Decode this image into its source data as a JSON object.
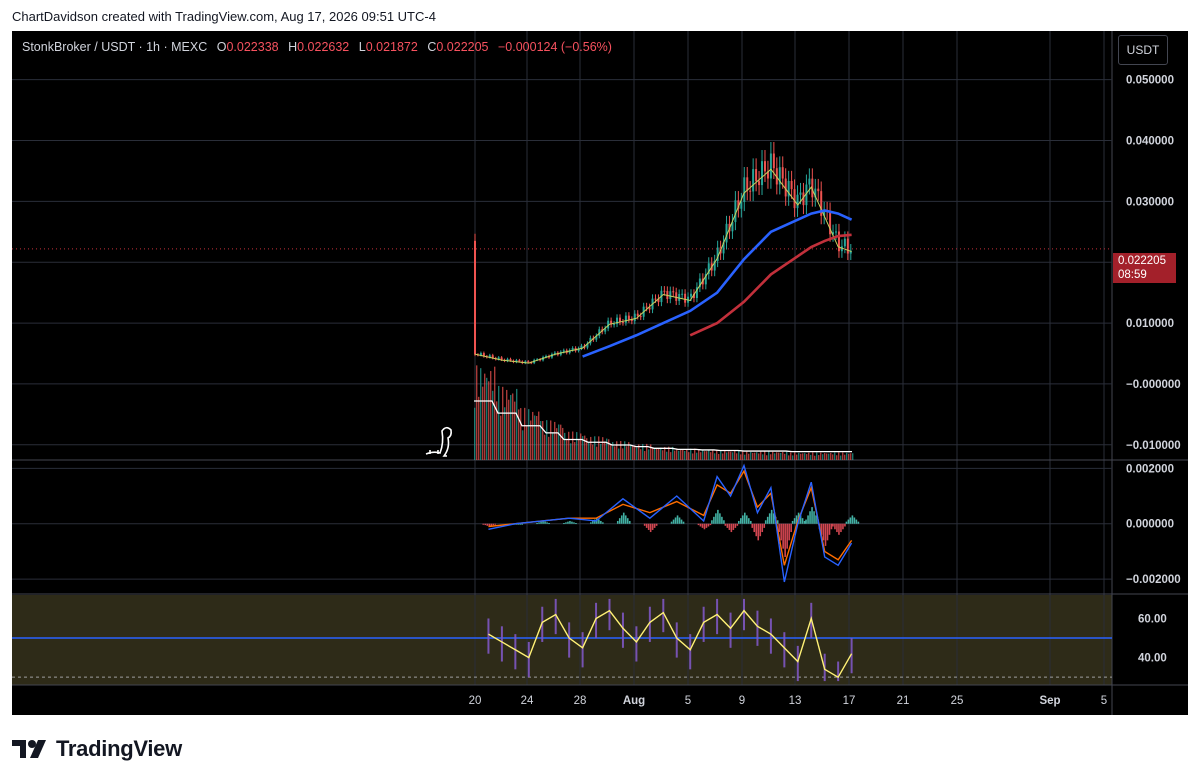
{
  "credit": "ChartDavidson created with TradingView.com, Aug 17, 2026 09:51 UTC-4",
  "legend": {
    "symbol": "StonkBroker / USDT · 1h · MEXC",
    "open_label": "O",
    "open": "0.022338",
    "high_label": "H",
    "high": "0.022632",
    "low_label": "L",
    "low": "0.021872",
    "close_label": "C",
    "close": "0.022205",
    "change": "−0.000124 (−0.56%)"
  },
  "currency_button": "USDT",
  "last_price_tag": {
    "price": "0.022205",
    "countdown": "08:59"
  },
  "brand": "TradingView",
  "colors": {
    "candle_up": "#26a69a",
    "candle_down": "#ef5350",
    "ma_fast": "#2962ff",
    "ma_slow": "#c2303b",
    "macd_line": "#2962ff",
    "macd_signal": "#ff6d00",
    "rsi_line": "#fff176",
    "rsi_band": "#7e57c2",
    "rsi_mid": "#2962ff"
  },
  "chart_data": [
    {
      "type": "line",
      "panel": "price",
      "y_ticks": [
        "0.050000",
        "0.040000",
        "0.030000",
        "0.020000",
        "0.010000",
        "−0.000000",
        "−0.010000"
      ],
      "ylim": [
        -0.0125,
        0.058
      ],
      "x_ticks": [
        "20",
        "24",
        "28",
        "Aug",
        "5",
        "9",
        "13",
        "17",
        "21",
        "25",
        "Sep",
        "5"
      ],
      "x": [
        20,
        22,
        24,
        26,
        28,
        30,
        32,
        34,
        36,
        38,
        40,
        42,
        44,
        45,
        46,
        47,
        48
      ],
      "series": [
        {
          "values": [
            0.005,
            0.004,
            0.0035,
            0.005,
            0.006,
            0.01,
            0.011,
            0.015,
            0.014,
            0.021,
            0.032,
            0.036,
            0.03,
            0.033,
            0.028,
            0.023,
            0.0222
          ]
        },
        {
          "values": [
            null,
            null,
            null,
            null,
            0.0045,
            0.0062,
            0.008,
            0.01,
            0.012,
            0.015,
            0.0205,
            0.025,
            0.027,
            0.028,
            0.0285,
            0.028,
            0.027
          ]
        },
        {
          "values": [
            null,
            null,
            null,
            null,
            null,
            null,
            null,
            null,
            0.008,
            0.01,
            0.0135,
            0.018,
            0.021,
            0.0225,
            0.0235,
            0.0243,
            0.0245
          ]
        }
      ],
      "volume_profile": [
        1.0,
        0.78,
        0.55,
        0.42,
        0.3,
        0.25,
        0.2,
        0.17,
        0.14,
        0.12,
        0.11,
        0.1,
        0.09,
        0.09,
        0.08,
        0.08,
        0.08
      ]
    },
    {
      "type": "line",
      "panel": "macd",
      "y_ticks": [
        "0.002000",
        "0.000000",
        "−0.002000"
      ],
      "ylim": [
        -0.0025,
        0.0023
      ],
      "x": [
        21,
        23,
        25,
        27,
        29,
        31,
        33,
        35,
        37,
        38,
        39,
        40,
        41,
        42,
        43,
        44,
        45,
        46,
        47,
        48
      ],
      "series": [
        {
          "values": [
            -0.0002,
            0.0,
            0.0001,
            0.0002,
            0.0001,
            0.0009,
            0.0002,
            0.001,
            0.0001,
            0.0017,
            0.001,
            0.0021,
            0.0004,
            0.0013,
            -0.0021,
            0.0,
            0.0015,
            -0.0012,
            -0.0015,
            -0.0007
          ]
        },
        {
          "values": [
            -0.0001,
            0.0,
            0.0001,
            0.0002,
            0.0002,
            0.0007,
            0.0004,
            0.0008,
            0.0003,
            0.0014,
            0.0011,
            0.0019,
            0.0006,
            0.0011,
            -0.0015,
            0.0001,
            0.0013,
            -0.001,
            -0.0013,
            -0.0006
          ]
        }
      ],
      "histogram": [
        -0.0001,
        0.0,
        0.0001,
        0.0001,
        0.0002,
        0.0004,
        -0.0003,
        0.0003,
        -0.0002,
        0.0005,
        -0.0003,
        0.0004,
        -0.0006,
        0.0005,
        -0.0012,
        0.0004,
        0.0006,
        -0.0008,
        -0.0004,
        0.0003
      ]
    },
    {
      "type": "line",
      "panel": "rsi",
      "y_ticks": [
        "60.00",
        "40.00"
      ],
      "ylim": [
        26,
        72
      ],
      "x": [
        21,
        22,
        23,
        24,
        25,
        26,
        27,
        28,
        29,
        30,
        31,
        32,
        33,
        34,
        35,
        36,
        37,
        38,
        39,
        40,
        41,
        42,
        43,
        44,
        45,
        46,
        47,
        48
      ],
      "series": [
        {
          "values": [
            52,
            48,
            44,
            40,
            58,
            62,
            50,
            45,
            60,
            64,
            55,
            48,
            58,
            63,
            50,
            44,
            58,
            62,
            55,
            64,
            56,
            52,
            45,
            38,
            60,
            34,
            30,
            42
          ]
        }
      ],
      "midline": 50,
      "band": [
        30,
        70
      ]
    }
  ]
}
